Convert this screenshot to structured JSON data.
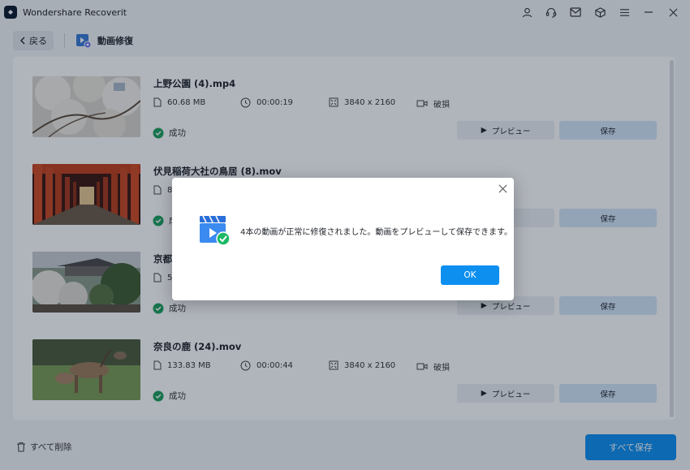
{
  "app": {
    "title": "Wondershare Recoverit"
  },
  "titlebar_icons": [
    "user-icon",
    "support-headset-icon",
    "mail-icon",
    "cube-icon",
    "menu-icon",
    "minimize-icon",
    "close-icon"
  ],
  "nav": {
    "back_label": "戻る",
    "page_title": "動画修復"
  },
  "files": [
    {
      "name": "上野公園 (4).mp4",
      "size": "60.68 MB",
      "duration": "00:00:19",
      "resolution": "3840 x 2160",
      "condition": "破損",
      "status": "成功",
      "preview_label": "プレビュー",
      "save_label": "保存"
    },
    {
      "name": "伏見稲荷大社の鳥居 (8).mov",
      "size": "8",
      "duration": "",
      "resolution": "",
      "condition": "",
      "status": "成",
      "preview_label": "ュー",
      "save_label": "保存"
    },
    {
      "name": "京都",
      "size": "5",
      "duration": "",
      "resolution": "",
      "condition": "",
      "status": "成功",
      "preview_label": "プレビュー",
      "save_label": "保存"
    },
    {
      "name": "奈良の鹿 (24).mov",
      "size": "133.83 MB",
      "duration": "00:00:44",
      "resolution": "3840 x 2160",
      "condition": "破損",
      "status": "成功",
      "preview_label": "プレビュー",
      "save_label": "保存"
    }
  ],
  "footer": {
    "delete_all_label": "すべて削除",
    "save_all_label": "すべて保存"
  },
  "dialog": {
    "message": "4本の動画が正常に修復されました。動画をプレビューして保存できます。",
    "ok_label": "OK"
  },
  "colors": {
    "accent": "#0d8ff0",
    "success": "#1aa05a",
    "save_button": "#d6e8fa"
  }
}
